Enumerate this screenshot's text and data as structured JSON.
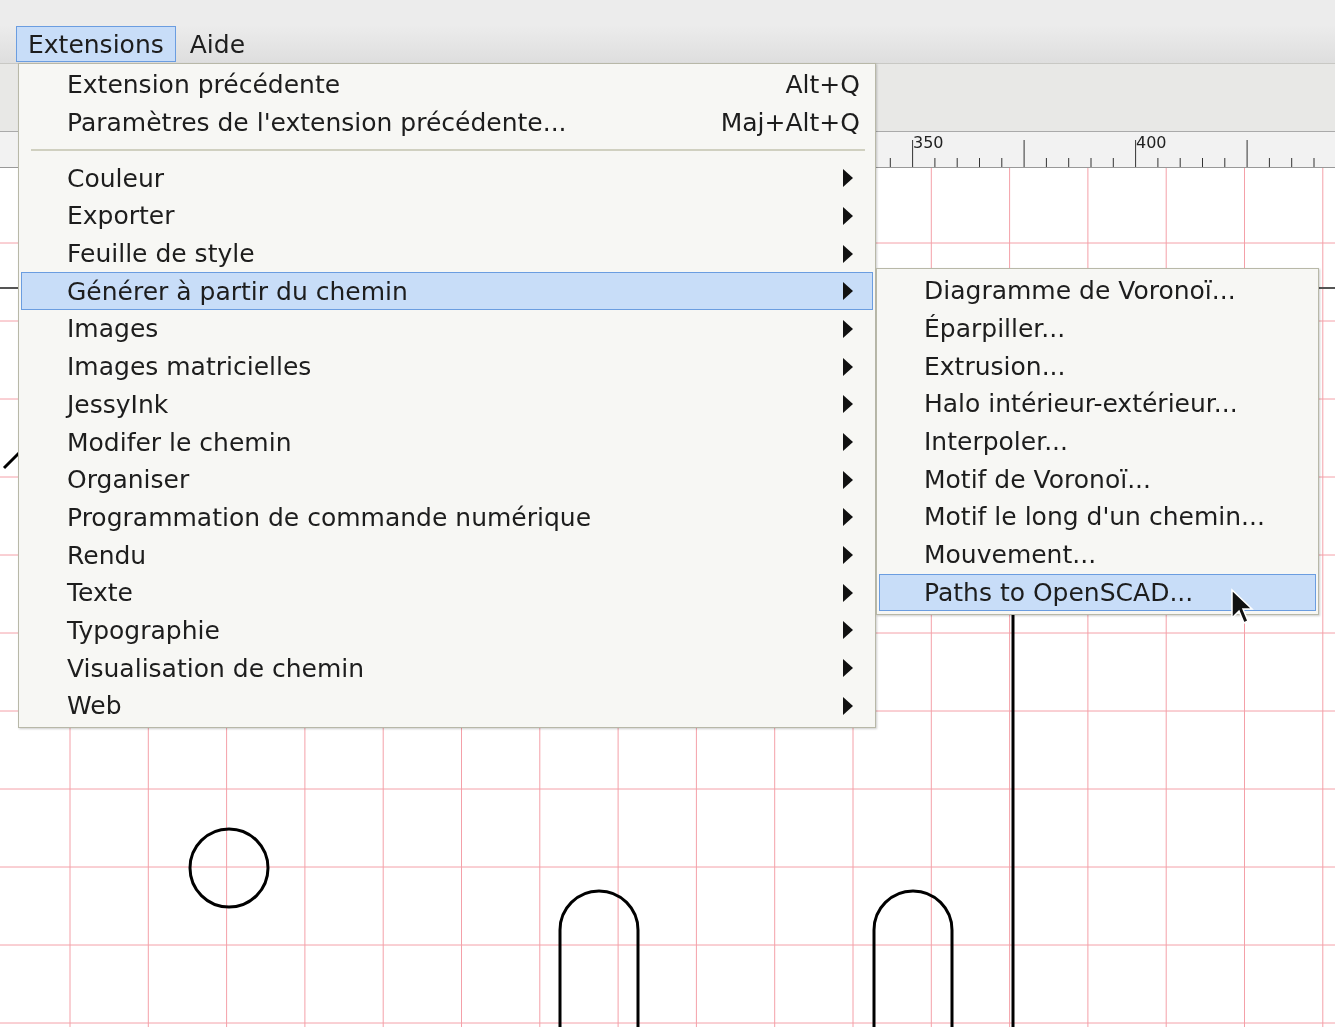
{
  "menubar": [
    {
      "label": "Extensions",
      "selected": true
    },
    {
      "label": "Aide",
      "selected": false
    }
  ],
  "ruler": {
    "labels": [
      "350",
      "400"
    ]
  },
  "menu": {
    "items": [
      {
        "kind": "command",
        "label": "Extension précédente",
        "shortcut": "Alt+Q",
        "selected": false
      },
      {
        "kind": "command",
        "label": "Paramètres de l'extension précédente...",
        "shortcut": "Maj+Alt+Q",
        "selected": false
      },
      {
        "kind": "separator"
      },
      {
        "kind": "submenu",
        "label": "Couleur",
        "selected": false
      },
      {
        "kind": "submenu",
        "label": "Exporter",
        "selected": false
      },
      {
        "kind": "submenu",
        "label": "Feuille de style",
        "selected": false
      },
      {
        "kind": "submenu",
        "label": "Générer à partir du chemin",
        "selected": true
      },
      {
        "kind": "submenu",
        "label": "Images",
        "selected": false
      },
      {
        "kind": "submenu",
        "label": "Images matricielles",
        "selected": false
      },
      {
        "kind": "submenu",
        "label": "JessyInk",
        "selected": false
      },
      {
        "kind": "submenu",
        "label": "Modifer le chemin",
        "selected": false
      },
      {
        "kind": "submenu",
        "label": "Organiser",
        "selected": false
      },
      {
        "kind": "submenu",
        "label": "Programmation de commande numérique",
        "selected": false
      },
      {
        "kind": "submenu",
        "label": "Rendu",
        "selected": false
      },
      {
        "kind": "submenu",
        "label": "Texte",
        "selected": false
      },
      {
        "kind": "submenu",
        "label": "Typographie",
        "selected": false
      },
      {
        "kind": "submenu",
        "label": "Visualisation de chemin",
        "selected": false
      },
      {
        "kind": "submenu",
        "label": "Web",
        "selected": false
      }
    ]
  },
  "submenu": {
    "items": [
      {
        "label": "Diagramme de Voronoï...",
        "selected": false
      },
      {
        "label": "Éparpiller...",
        "selected": false
      },
      {
        "label": "Extrusion...",
        "selected": false
      },
      {
        "label": "Halo intérieur-extérieur...",
        "selected": false
      },
      {
        "label": "Interpoler...",
        "selected": false
      },
      {
        "label": "Motif de Voronoï...",
        "selected": false
      },
      {
        "label": "Motif le long d'un chemin...",
        "selected": false
      },
      {
        "label": "Mouvement...",
        "selected": false
      },
      {
        "label": "Paths to OpenSCAD...",
        "selected": true
      }
    ]
  }
}
